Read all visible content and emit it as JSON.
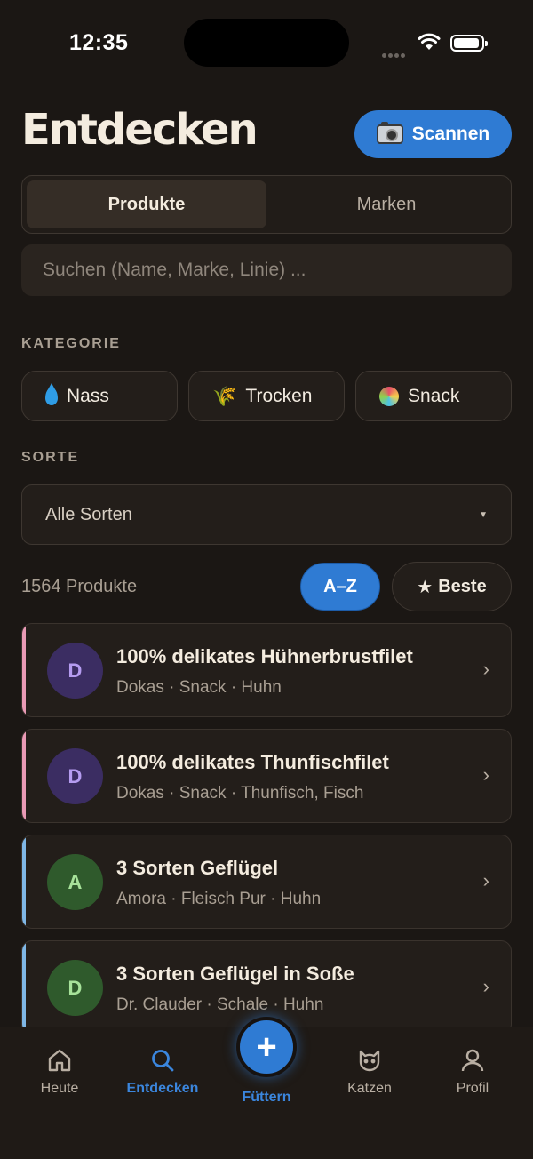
{
  "status": {
    "time": "12:35"
  },
  "header": {
    "title": "Entdecken",
    "scan_label": "Scannen"
  },
  "segments": [
    {
      "label": "Produkte",
      "active": true
    },
    {
      "label": "Marken",
      "active": false
    }
  ],
  "search": {
    "placeholder": "Suchen (Name, Marke, Linie) ...",
    "value": ""
  },
  "category": {
    "label": "KATEGORIE",
    "chips": [
      {
        "icon": "water-drop-icon",
        "label": "Nass"
      },
      {
        "icon": "wheat-icon",
        "label": "Trocken"
      },
      {
        "icon": "lollipop-icon",
        "label": "Snack"
      }
    ]
  },
  "sort": {
    "label": "SORTE",
    "selected": "Alle Sorten"
  },
  "results": {
    "count_text": "1564 Produkte",
    "az_label": "A–Z",
    "best_label": "Beste"
  },
  "products": [
    {
      "initial": "D",
      "name": "100% delikates Hühnerbrustfilet",
      "meta": "Dokas · Snack · Huhn",
      "accent": "#e99ab5",
      "avatar_bg": "#3b2d62",
      "avatar_fg": "#b59cf0"
    },
    {
      "initial": "D",
      "name": "100% delikates Thunfischfilet",
      "meta": "Dokas · Snack · Thunfisch, Fisch",
      "accent": "#e99ab5",
      "avatar_bg": "#3b2d62",
      "avatar_fg": "#b59cf0"
    },
    {
      "initial": "A",
      "name": "3 Sorten Geflügel",
      "meta": "Amora · Fleisch Pur · Huhn",
      "accent": "#7fb7e6",
      "avatar_bg": "#2f5a2c",
      "avatar_fg": "#a7e29a"
    },
    {
      "initial": "D",
      "name": "3 Sorten Geflügel in Soße",
      "meta": "Dr. Clauder · Schale · Huhn",
      "accent": "#7fb7e6",
      "avatar_bg": "#2f5a2c",
      "avatar_fg": "#a7e29a"
    }
  ],
  "tabs": {
    "heute": "Heute",
    "entdecken": "Entdecken",
    "fuettern": "Füttern",
    "katzen": "Katzen",
    "profil": "Profil"
  },
  "colors": {
    "accent": "#2f7bd3",
    "background": "#1b1714"
  }
}
